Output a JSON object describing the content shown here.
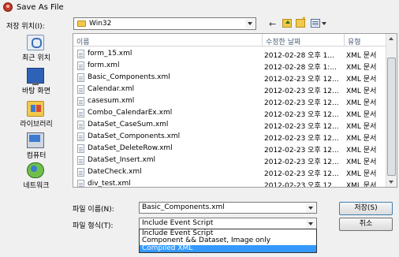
{
  "window": {
    "title": "Save As File"
  },
  "location": {
    "label": "저장 위치(I):",
    "folder": "Win32"
  },
  "places": [
    {
      "label": "최근 위치",
      "icon": "recent-places-icon"
    },
    {
      "label": "바탕 화면",
      "icon": "desktop-icon"
    },
    {
      "label": "라이브러리",
      "icon": "libraries-icon"
    },
    {
      "label": "컴퓨터",
      "icon": "computer-icon"
    },
    {
      "label": "네트워크",
      "icon": "network-icon"
    }
  ],
  "columns": {
    "name": "이름",
    "date": "수정한 날짜",
    "type": "유형"
  },
  "files": [
    {
      "name": "form_15.xml",
      "date": "2012-02-28 오후 1...",
      "type": "XML 문서"
    },
    {
      "name": "form.xml",
      "date": "2012-02-28 오후 1:...",
      "type": "XML 문서"
    },
    {
      "name": "Basic_Components.xml",
      "date": "2012-02-23 오후 12...",
      "type": "XML 문서"
    },
    {
      "name": "Calendar.xml",
      "date": "2012-02-23 오후 12...",
      "type": "XML 문서"
    },
    {
      "name": "casesum.xml",
      "date": "2012-02-23 오후 12...",
      "type": "XML 문서"
    },
    {
      "name": "Combo_CalendarEx.xml",
      "date": "2012-02-23 오후 12...",
      "type": "XML 문서"
    },
    {
      "name": "DataSet_CaseSum.xml",
      "date": "2012-02-23 오후 12...",
      "type": "XML 문서"
    },
    {
      "name": "DataSet_Components.xml",
      "date": "2012-02-23 오후 12...",
      "type": "XML 문서"
    },
    {
      "name": "DataSet_DeleteRow.xml",
      "date": "2012-02-23 오후 12...",
      "type": "XML 문서"
    },
    {
      "name": "DataSet_Insert.xml",
      "date": "2012-02-23 오후 12...",
      "type": "XML 문서"
    },
    {
      "name": "DateCheck.xml",
      "date": "2012-02-23 오후 12...",
      "type": "XML 문서"
    },
    {
      "name": "div_test.xml",
      "date": "2012-02-23 오후 12...",
      "type": "XML 문서"
    }
  ],
  "filename": {
    "label": "파일 이름(N):",
    "value": "Basic_Components.xml"
  },
  "filetype": {
    "label": "파일 형식(T):",
    "value": "Include Event Script",
    "options": [
      "Include Event Script",
      "Component && Dataset, Image only",
      "Compiled XML"
    ],
    "highlighted": "Compiled XML"
  },
  "buttons": {
    "save": "저장(S)",
    "cancel": "취소"
  },
  "colors": {
    "selection": "#3399ff",
    "dialog": "#f0f0f0"
  }
}
